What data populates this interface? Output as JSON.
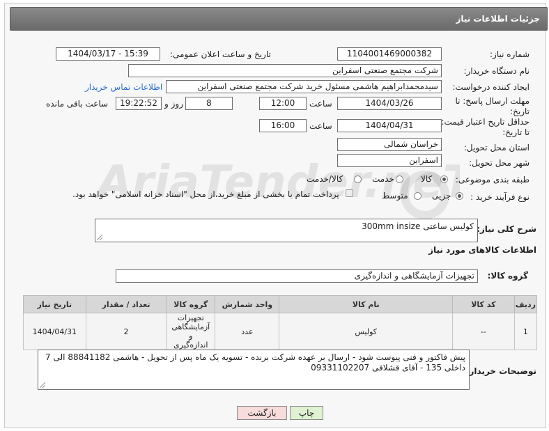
{
  "header": {
    "title": "جزئیات اطلاعات نیاز"
  },
  "fields": {
    "need_number_label": "شماره نیاز:",
    "need_number": "1104001469000382",
    "announce_label": "تاریخ و ساعت اعلان عمومی:",
    "announce_value": "1404/03/17 - 15:39",
    "buyer_org_label": "نام دستگاه خریدار:",
    "buyer_org": "شرکت مجتمع صنعتی اسفراین",
    "requester_label": "ایجاد کننده درخواست:",
    "requester": "سیدمحمدابراهیم هاشمی مسئول خرید شرکت مجتمع صنعتی اسفراین",
    "contact_link": "اطلاعات تماس خریدار",
    "deadline_label_1": "مهلت ارسال پاسخ: تا",
    "deadline_label_2": "تاریخ:",
    "deadline_date": "1404/03/26",
    "time_label": "ساعت",
    "deadline_time": "12:00",
    "days_value": "8",
    "days_label": "روز و",
    "remaining_time": "19:22:52",
    "remaining_label": "ساعت باقی مانده",
    "validity_label_1": "حداقل تاریخ اعتبار قیمت:",
    "validity_label_2": "تا تاریخ:",
    "validity_date": "1404/04/31",
    "validity_time_label": "ساعت",
    "validity_time": "16:00",
    "province_label": "استان محل تحویل:",
    "province": "خراسان شمالی",
    "city_label": "شهر محل تحویل:",
    "city": "اسفراین",
    "category_label": "طبقه بندی موضوعی:",
    "category_options": [
      "کالا",
      "خدمت",
      "کالا/خدمت"
    ],
    "process_label": "نوع فرآیند خرید :",
    "process_options": [
      "جزیی",
      "متوسط"
    ],
    "payment_note": "پرداخت تمام یا بخشی از مبلغ خرید،از محل \"اسناد خزانه اسلامی\" خواهد بود.",
    "description_label": "شرح کلی نیاز:",
    "description": "کولیس ساعتی 300mm insize",
    "goods_info_title": "اطلاعات کالاهای مورد نیاز",
    "goods_group_label": "گروه کالا:",
    "goods_group": "تجهیزات آزمایشگاهی و اندازه‌گیری"
  },
  "table": {
    "headers": [
      "ردیف",
      "کد کالا",
      "نام کالا",
      "واحد شمارش",
      "گروه کالا",
      "تعداد / مقدار",
      "تاریخ نیاز"
    ],
    "rows": [
      [
        "1",
        "--",
        "کولیس",
        "عدد",
        "تجهیزات آزمایشگاهی و اندازه‌گیری",
        "2",
        "1404/04/31"
      ]
    ]
  },
  "buyer_notes_label": "توضیحات خریدار:",
  "buyer_notes": "پیش فاکتور و فنی پیوست شود - ارسال بر عهده شرکت برنده - تسویه یک ماه پس از تحویل - هاشمی 88841182 الی 7 داخلی 135 - آقای قشلاقی 09331102207",
  "buttons": {
    "print": "چاپ",
    "back": "بازگشت"
  },
  "watermark": "AriaTender.neT",
  "colors": {
    "header_bg": "#777777",
    "print_btn": "#dff3d2",
    "back_btn": "#f7dcdc",
    "link": "#2a6fc9"
  }
}
